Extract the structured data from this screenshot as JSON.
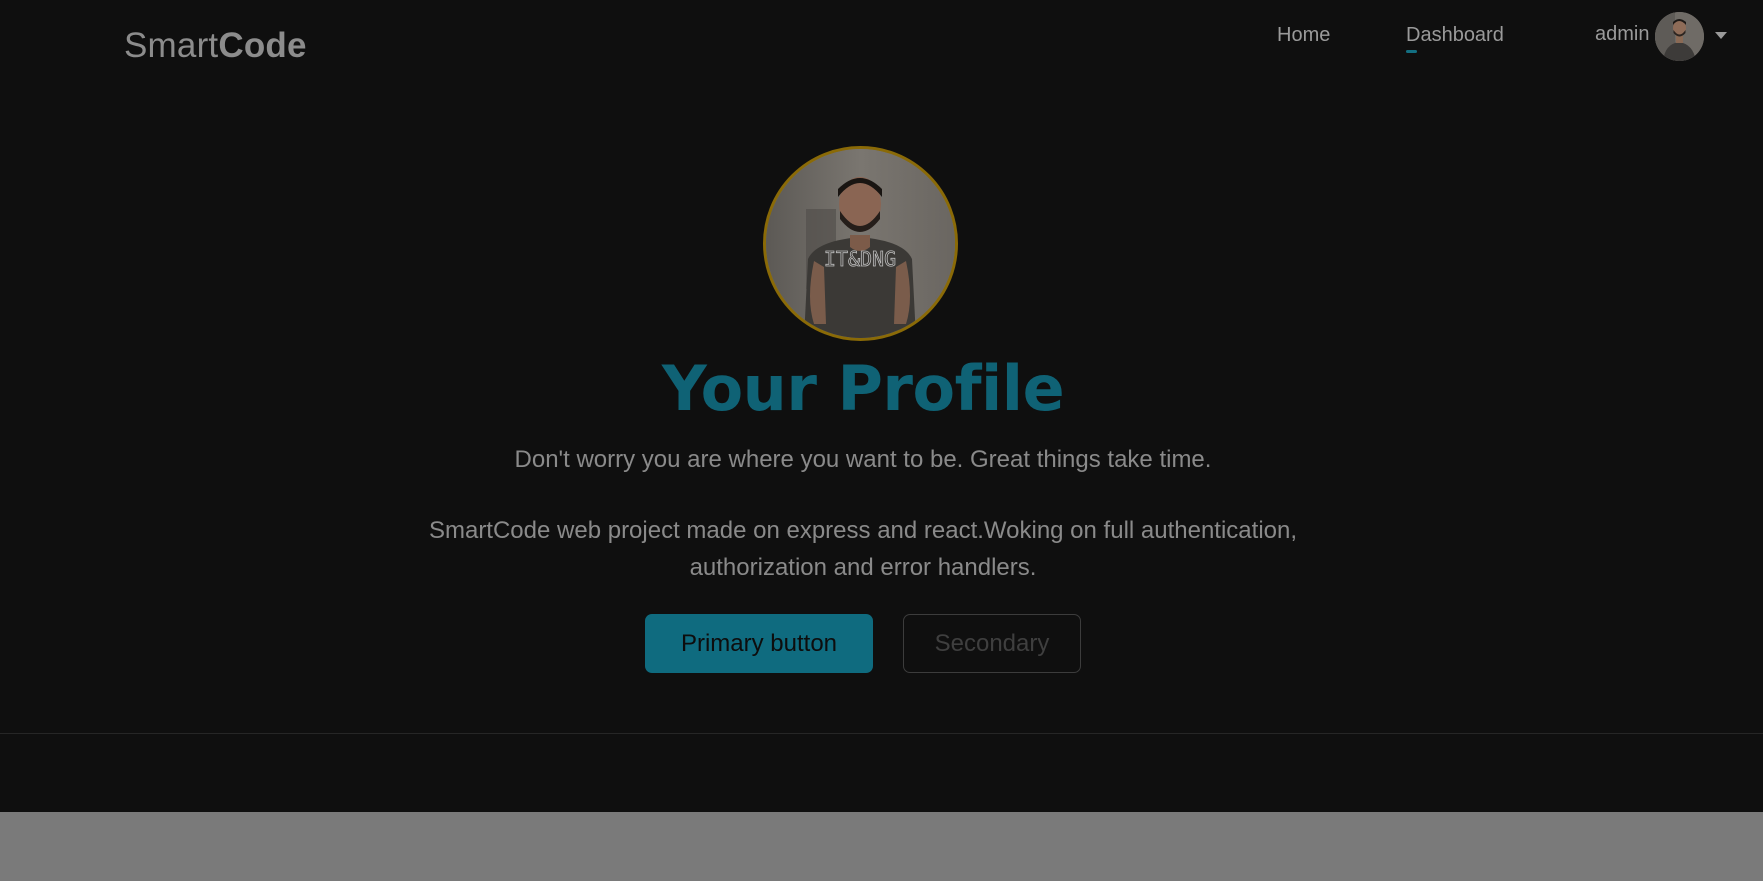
{
  "header": {
    "brand_light": "Smart",
    "brand_bold": "Code",
    "nav": [
      {
        "label": "Home"
      },
      {
        "label": "Dashboard"
      }
    ],
    "user": {
      "name": "admin"
    }
  },
  "hero": {
    "title": "Your Profile",
    "tagline": "Don't worry you are where you want to be. Great things take time.",
    "description": "SmartCode web project made on express and react.Woking on full authentication, authorization and error handlers.",
    "primary_button": "Primary button",
    "secondary_button": "Secondary",
    "shirt_text": "IT&DNG"
  },
  "colors": {
    "accent": "#0f6275",
    "avatar_ring": "#8a6a07",
    "background": "#0f0f0f"
  }
}
